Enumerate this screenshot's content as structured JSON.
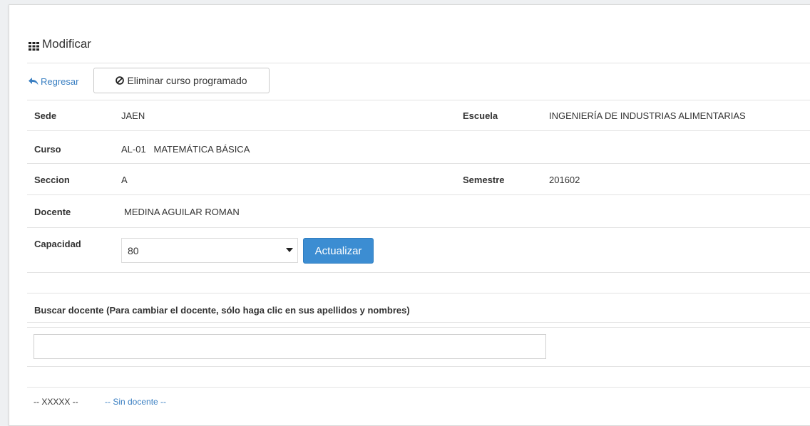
{
  "panel": {
    "title": "Modificar"
  },
  "actions": {
    "back_label": "Regresar",
    "delete_label": "Eliminar curso programado"
  },
  "details": {
    "sede_label": "Sede",
    "sede_value": "JAEN",
    "escuela_label": "Escuela",
    "escuela_value": "INGENIERÍA DE INDUSTRIAS ALIMENTARIAS",
    "curso_label": "Curso",
    "curso_value": "AL-01   MATEMÁTICA BÁSICA",
    "seccion_label": "Seccion",
    "seccion_value": "A",
    "semestre_label": "Semestre",
    "semestre_value": "201602",
    "docente_label": "Docente",
    "docente_value": "MEDINA AGUILAR ROMAN",
    "capacidad_label": "Capacidad",
    "capacidad_value": "80",
    "update_label": "Actualizar"
  },
  "search": {
    "label": "Buscar docente (Para cambiar el docente, sólo haga clic en sus apellidos y nombres)",
    "value": ""
  },
  "results": {
    "code": "-- XXXXX --",
    "name": "-- Sin docente --"
  },
  "colors": {
    "link": "#3a7fc2",
    "primary": "#3c8dd2"
  }
}
